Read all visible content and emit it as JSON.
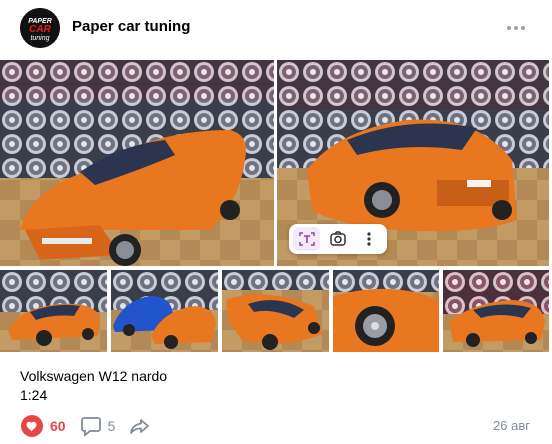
{
  "header": {
    "group_name": "Paper car tuning",
    "logo_text_top": "PAPER",
    "logo_text_mid": "CAR",
    "logo_text_bottom": "tuning"
  },
  "post": {
    "text_line1": "Volkswagen W12 nardo",
    "text_line2": "1:24",
    "likes": "60",
    "comments": "5",
    "date": "26 авг"
  },
  "overlay_toolbar": {
    "buttons": [
      "text-recognition-icon",
      "lens-search-icon",
      "more-vertical-icon"
    ]
  },
  "photos": [
    {
      "subject": "orange car front three-quarter view"
    },
    {
      "subject": "orange car rear view"
    },
    {
      "subject": "orange car side"
    },
    {
      "subject": "orange and blue cars"
    },
    {
      "subject": "orange car front"
    },
    {
      "subject": "orange car wheel close-up"
    },
    {
      "subject": "orange car rear three-quarter"
    }
  ],
  "colors": {
    "like": "#e64646",
    "muted": "#818c99",
    "car_orange": "#e8771f",
    "floor": "#b8925a"
  }
}
